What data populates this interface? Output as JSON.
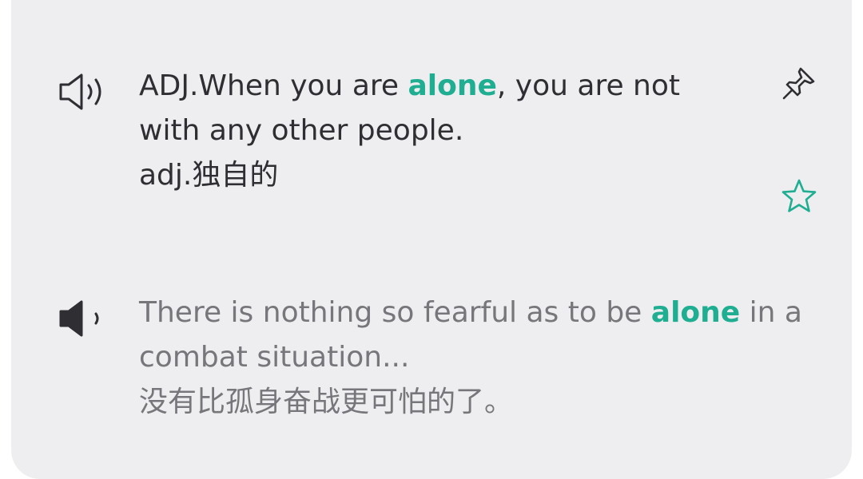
{
  "definition": {
    "before": "ADJ.When you are ",
    "keyword": "alone",
    "after_line1": ", you are not",
    "line2": "with any other people.",
    "translation": "adj.独自的"
  },
  "example": {
    "before": "There is nothing so fearful as to be ",
    "keyword": "alone",
    "after_line1": " in a",
    "line2": "combat situation...",
    "translation": "没有比孤身奋战更可怕的了。"
  },
  "icons": {
    "definition_audio": "speaker-outline-icon",
    "example_audio": "speaker-filled-icon",
    "pin": "pin-icon",
    "favorite": "star-outline-icon"
  },
  "colors": {
    "accent": "#1fae92",
    "definition_text": "#2f2f33",
    "example_text": "#77777b",
    "card_background": "#eeeef0"
  }
}
